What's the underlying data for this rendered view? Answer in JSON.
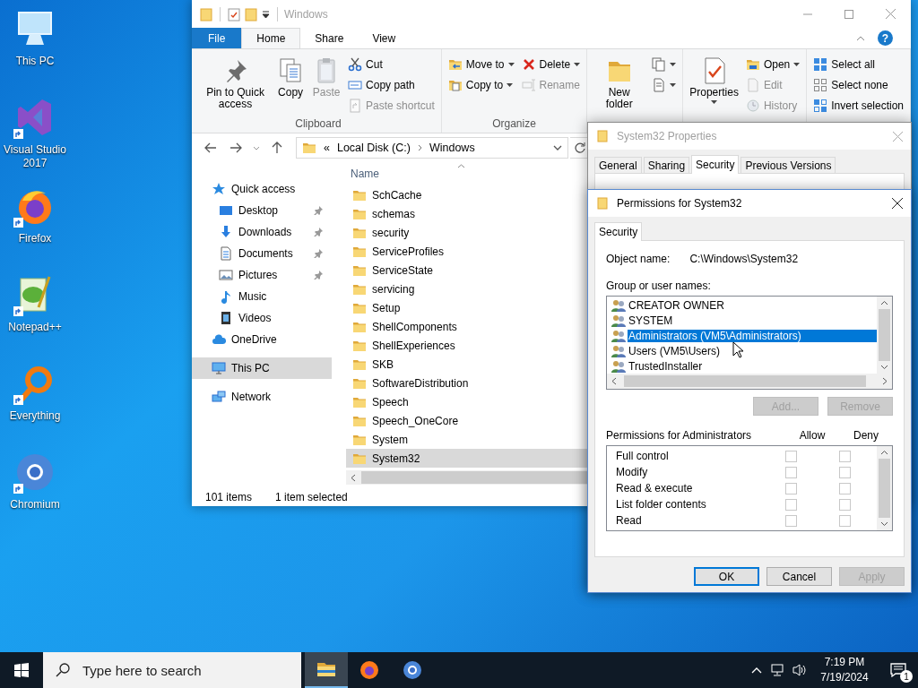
{
  "desktop_icons": [
    {
      "label": "This PC",
      "shortcut": false
    },
    {
      "label": "Visual Studio 2017",
      "shortcut": true
    },
    {
      "label": "Firefox",
      "shortcut": true
    },
    {
      "label": "Notepad++",
      "shortcut": true
    },
    {
      "label": "Everything",
      "shortcut": true
    },
    {
      "label": "Chromium",
      "shortcut": true
    }
  ],
  "explorer": {
    "title": "Windows",
    "help_glyph": "?",
    "tabs": [
      {
        "label": "File",
        "kind": "file",
        "selected": false
      },
      {
        "label": "Home",
        "kind": "tab",
        "selected": true
      },
      {
        "label": "Share",
        "kind": "tab",
        "selected": false
      },
      {
        "label": "View",
        "kind": "tab",
        "selected": false
      }
    ],
    "ribbon_groups": [
      {
        "label": "Clipboard",
        "columns": [
          [
            {
              "kind": "large",
              "label": "Pin to Quick access",
              "disabled": false,
              "dropdown": false
            }
          ],
          [
            {
              "kind": "large",
              "label": "Copy",
              "disabled": false,
              "dropdown": false
            }
          ],
          [
            {
              "kind": "large",
              "label": "Paste",
              "disabled": true,
              "dropdown": false
            }
          ],
          [
            {
              "kind": "small",
              "label": "Cut",
              "disabled": false,
              "dropdown": false
            },
            {
              "kind": "small",
              "label": "Copy path",
              "disabled": false,
              "dropdown": false
            },
            {
              "kind": "small",
              "label": "Paste shortcut",
              "disabled": true,
              "dropdown": false
            }
          ]
        ]
      },
      {
        "label": "Organize",
        "columns": [
          [
            {
              "kind": "small",
              "label": "Move to",
              "disabled": false,
              "dropdown": true
            },
            {
              "kind": "small",
              "label": "Copy to",
              "disabled": false,
              "dropdown": true
            }
          ],
          [
            {
              "kind": "small",
              "label": "Delete",
              "disabled": false,
              "dropdown": true
            },
            {
              "kind": "small",
              "label": "Rename",
              "disabled": true,
              "dropdown": false
            }
          ]
        ]
      },
      {
        "columns": [
          [
            {
              "kind": "large",
              "label": "New folder",
              "disabled": false,
              "dropdown": false
            }
          ],
          [
            {
              "kind": "icon",
              "disabled": false,
              "dropdown": true
            },
            {
              "kind": "icon",
              "disabled": false,
              "dropdown": true
            }
          ]
        ]
      },
      {
        "columns": [
          [
            {
              "kind": "large",
              "label": "Properties",
              "disabled": false,
              "dropdown": true
            }
          ],
          [
            {
              "kind": "small",
              "label": "Open",
              "disabled": false,
              "dropdown": true
            },
            {
              "kind": "small",
              "label": "Edit",
              "disabled": true,
              "dropdown": false
            },
            {
              "kind": "small",
              "label": "History",
              "disabled": true,
              "dropdown": false
            }
          ]
        ]
      },
      {
        "columns": [
          [
            {
              "kind": "small",
              "label": "Select all",
              "disabled": false,
              "dropdown": false
            },
            {
              "kind": "small",
              "label": "Select none",
              "disabled": false,
              "dropdown": false
            },
            {
              "kind": "small",
              "label": "Invert selection",
              "disabled": false,
              "dropdown": false
            }
          ]
        ]
      }
    ],
    "address": {
      "overflow_mark": "«",
      "path": [
        "Local Disk (C:)",
        "Windows"
      ]
    },
    "nav": [
      {
        "label": "Quick access",
        "selected": false,
        "children": [
          {
            "label": "Desktop",
            "selected": false,
            "pinned": true
          },
          {
            "label": "Downloads",
            "selected": false,
            "pinned": true
          },
          {
            "label": "Documents",
            "selected": false,
            "pinned": true
          },
          {
            "label": "Pictures",
            "selected": false,
            "pinned": true
          },
          {
            "label": "Music",
            "selected": false,
            "pinned": false
          },
          {
            "label": "Videos",
            "selected": false,
            "pinned": false
          }
        ]
      },
      {
        "label": "OneDrive",
        "selected": false
      },
      {
        "label": "This PC",
        "selected": true
      },
      {
        "label": "Network",
        "selected": false
      }
    ],
    "column_header": "Name",
    "files": [
      {
        "name": "SchCache",
        "selected": false
      },
      {
        "name": "schemas",
        "selected": false
      },
      {
        "name": "security",
        "selected": false
      },
      {
        "name": "ServiceProfiles",
        "selected": false
      },
      {
        "name": "ServiceState",
        "selected": false
      },
      {
        "name": "servicing",
        "selected": false
      },
      {
        "name": "Setup",
        "selected": false
      },
      {
        "name": "ShellComponents",
        "selected": false
      },
      {
        "name": "ShellExperiences",
        "selected": false
      },
      {
        "name": "SKB",
        "selected": false
      },
      {
        "name": "SoftwareDistribution",
        "selected": false
      },
      {
        "name": "Speech",
        "selected": false
      },
      {
        "name": "Speech_OneCore",
        "selected": false
      },
      {
        "name": "System",
        "selected": false
      },
      {
        "name": "System32",
        "selected": true
      }
    ],
    "status": {
      "count": "101 items",
      "selection": "1 item selected"
    }
  },
  "properties_dialog": {
    "title": "System32 Properties",
    "tabs": [
      {
        "label": "General",
        "selected": false
      },
      {
        "label": "Sharing",
        "selected": false
      },
      {
        "label": "Security",
        "selected": true
      },
      {
        "label": "Previous Versions",
        "selected": false
      }
    ]
  },
  "permissions_dialog": {
    "title": "Permissions for System32",
    "tabs": [
      {
        "label": "Security",
        "selected": true
      }
    ],
    "object_label": "Object name:",
    "object_value": "C:\\Windows\\System32",
    "users_label": "Group or user names:",
    "users": [
      {
        "name": "CREATOR OWNER",
        "selected": false
      },
      {
        "name": "SYSTEM",
        "selected": false
      },
      {
        "name": "Administrators (VM5\\Administrators)",
        "selected": true
      },
      {
        "name": "Users (VM5\\Users)",
        "selected": false
      },
      {
        "name": "TrustedInstaller",
        "selected": false
      }
    ],
    "user_buttons": [
      {
        "label": "Add...",
        "disabled": true
      },
      {
        "label": "Remove",
        "disabled": true
      }
    ],
    "permissions_label": "Permissions for Administrators",
    "allow_label": "Allow",
    "deny_label": "Deny",
    "permissions": [
      {
        "name": "Full control",
        "allow": false,
        "deny": false
      },
      {
        "name": "Modify",
        "allow": false,
        "deny": false
      },
      {
        "name": "Read & execute",
        "allow": false,
        "deny": false
      },
      {
        "name": "List folder contents",
        "allow": false,
        "deny": false
      },
      {
        "name": "Read",
        "allow": false,
        "deny": false
      }
    ],
    "buttons": [
      {
        "label": "OK",
        "disabled": false,
        "default": true
      },
      {
        "label": "Cancel",
        "disabled": false,
        "default": false
      },
      {
        "label": "Apply",
        "disabled": true,
        "default": false
      }
    ]
  },
  "taskbar": {
    "search_placeholder": "Type here to search",
    "apps": [
      {
        "active": true
      },
      {
        "active": false
      },
      {
        "active": false
      }
    ],
    "time": "7:19 PM",
    "date": "7/19/2024",
    "notification_count": "1"
  }
}
